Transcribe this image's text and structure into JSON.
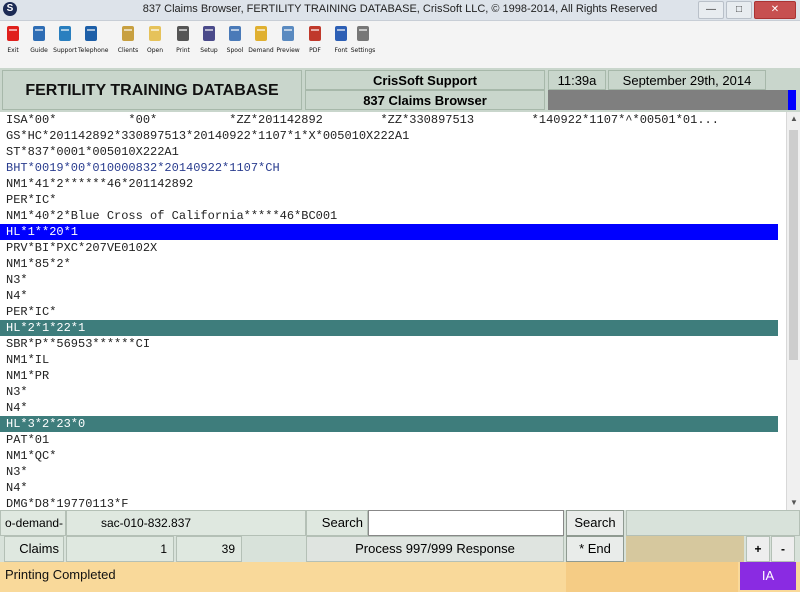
{
  "window": {
    "title": "837 Claims Browser, FERTILITY TRAINING DATABASE, CrisSoft LLC, © 1998-2014, All Rights Reserved",
    "app_icon": "S",
    "minimize": "—",
    "maximize": "□",
    "close": "✕"
  },
  "toolbar": [
    {
      "label": "Exit",
      "icon": "exit-icon",
      "color": "#e0201c"
    },
    {
      "label": "Guide",
      "icon": "guide-icon",
      "color": "#2e6db4"
    },
    {
      "label": "Support",
      "icon": "support-icon",
      "color": "#2a7fbf"
    },
    {
      "label": "Telephone",
      "icon": "telephone-icon",
      "color": "#1d5fa8"
    },
    {
      "label": "Clients",
      "icon": "clients-icon",
      "color": "#c8a040"
    },
    {
      "label": "Open",
      "icon": "open-icon",
      "color": "#e6c25a"
    },
    {
      "label": "Print",
      "icon": "print-icon",
      "color": "#555555"
    },
    {
      "label": "Setup",
      "icon": "setup-icon",
      "color": "#4a4a8a"
    },
    {
      "label": "Spool",
      "icon": "spool-icon",
      "color": "#4a7ab8"
    },
    {
      "label": "Demand",
      "icon": "demand-icon",
      "color": "#e0b030"
    },
    {
      "label": "Preview",
      "icon": "preview-icon",
      "color": "#5a8ac0"
    },
    {
      "label": "PDF",
      "icon": "pdf-icon",
      "color": "#c0392b"
    },
    {
      "label": "Font",
      "icon": "font-icon",
      "color": "#2d5fb5"
    },
    {
      "label": "Settings",
      "icon": "settings-icon",
      "color": "#777777"
    }
  ],
  "header": {
    "db_title": "FERTILITY TRAINING DATABASE",
    "support": "CrisSoft Support",
    "browser": "837 Claims Browser",
    "time": "11:39a",
    "date": "September 29th, 2014"
  },
  "content": {
    "lines": [
      {
        "text": "ISA*00*          *00*          *ZZ*201142892        *ZZ*330897513        *140922*1107*^*00501*01...",
        "style": ""
      },
      {
        "text": "GS*HC*201142892*330897513*20140922*1107*1*X*005010X222A1",
        "style": ""
      },
      {
        "text": "ST*837*0001*005010X222A1",
        "style": ""
      },
      {
        "text": "BHT*0019*00*010000832*20140922*1107*CH",
        "style": "bluetext"
      },
      {
        "text": "NM1*41*2******46*201142892",
        "style": ""
      },
      {
        "text": "PER*IC*",
        "style": ""
      },
      {
        "text": "NM1*40*2*Blue Cross of California*****46*BC001",
        "style": ""
      },
      {
        "text": "HL*1**20*1",
        "style": "hl-blue"
      },
      {
        "text": "PRV*BI*PXC*207VE0102X",
        "style": ""
      },
      {
        "text": "NM1*85*2*",
        "style": ""
      },
      {
        "text": "N3*",
        "style": ""
      },
      {
        "text": "N4*",
        "style": ""
      },
      {
        "text": "PER*IC*",
        "style": ""
      },
      {
        "text": "HL*2*1*22*1",
        "style": "hl-teal"
      },
      {
        "text": "SBR*P**56953******CI",
        "style": ""
      },
      {
        "text": "NM1*IL",
        "style": ""
      },
      {
        "text": "NM1*PR",
        "style": ""
      },
      {
        "text": "N3*",
        "style": ""
      },
      {
        "text": "N4*",
        "style": ""
      },
      {
        "text": "HL*3*2*23*0",
        "style": "hl-teal"
      },
      {
        "text": "PAT*01",
        "style": ""
      },
      {
        "text": "NM1*QC*",
        "style": ""
      },
      {
        "text": "N3*",
        "style": ""
      },
      {
        "text": "N4*",
        "style": ""
      },
      {
        "text": "DMG*D8*19770113*F",
        "style": ""
      }
    ]
  },
  "bottom": {
    "left_field": "o-demand-",
    "claim_id": "sac-010-832.837",
    "search_label": "Search",
    "search_value": "",
    "search_button": "Search",
    "claims_label": "Claims",
    "claims_current": "1",
    "claims_total": "39",
    "process_button": "Process 997/999 Response",
    "end_button": "* End",
    "plus": "+",
    "minus": "-"
  },
  "status": {
    "text": "Printing Completed",
    "badge": "IA"
  }
}
